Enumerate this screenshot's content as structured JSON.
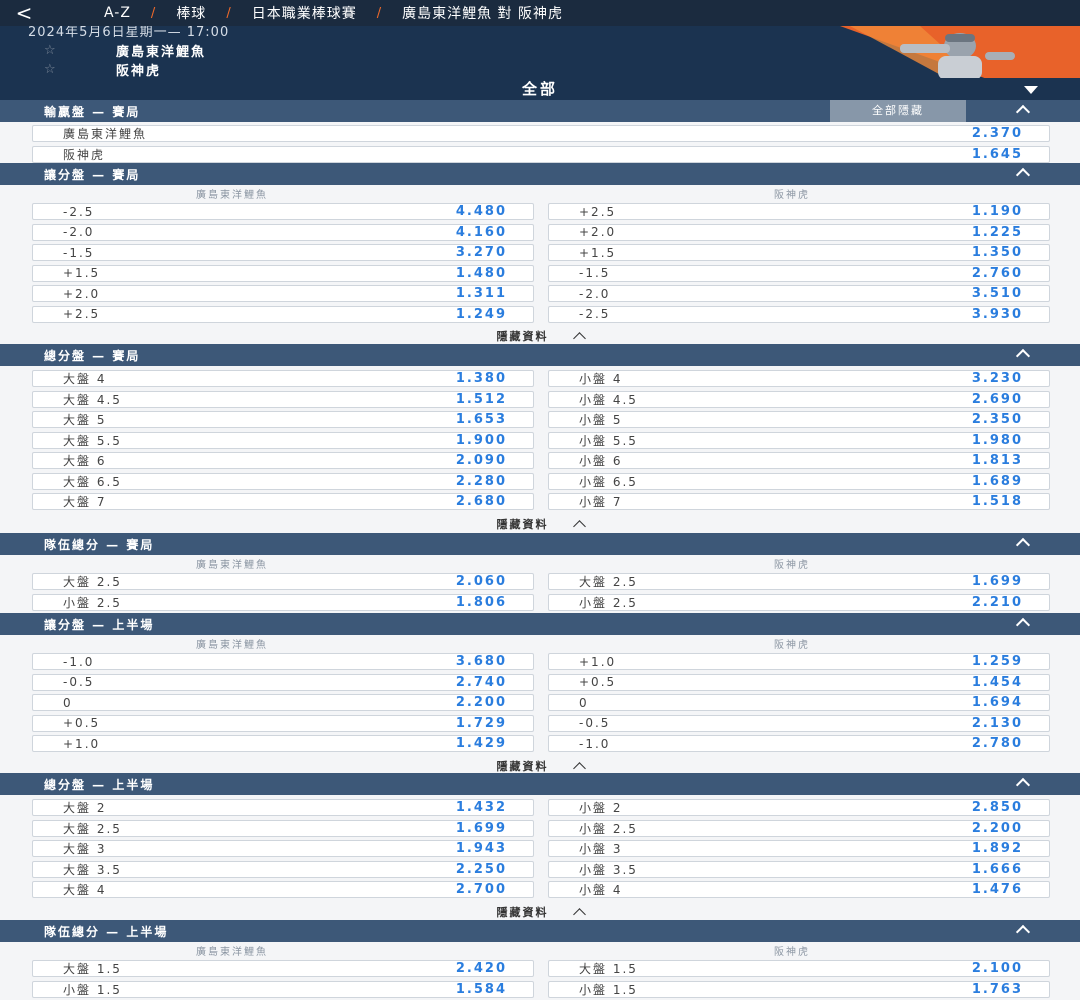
{
  "header": {
    "back": "<",
    "crumbs": [
      "A-Z",
      "棒球",
      "日本職業棒球賽",
      "廣島東洋鯉魚 對 阪神虎"
    ]
  },
  "match": {
    "datetime": "2024年5月6日星期一— 17:00",
    "home": "廣島東洋鯉魚",
    "away": "阪神虎",
    "star": "☆"
  },
  "filter": {
    "label": "全部"
  },
  "hide_all_label": "全部隱藏",
  "hide_data_label": "隱藏資料",
  "moneyline": {
    "title": "輸贏盤 — 賽局",
    "rows": [
      {
        "label": "廣島東洋鯉魚",
        "odds": "2.370"
      },
      {
        "label": "阪神虎",
        "odds": "1.645"
      }
    ]
  },
  "sections": [
    {
      "title": "讓分盤 — 賽局",
      "teams": [
        "廣島東洋鯉魚",
        "阪神虎"
      ],
      "rows": [
        [
          {
            "label": "-2.5",
            "odds": "4.480"
          },
          {
            "label": "+2.5",
            "odds": "1.190"
          }
        ],
        [
          {
            "label": "-2.0",
            "odds": "4.160"
          },
          {
            "label": "+2.0",
            "odds": "1.225"
          }
        ],
        [
          {
            "label": "-1.5",
            "odds": "3.270"
          },
          {
            "label": "+1.5",
            "odds": "1.350"
          }
        ],
        [
          {
            "label": "+1.5",
            "odds": "1.480"
          },
          {
            "label": "-1.5",
            "odds": "2.760"
          }
        ],
        [
          {
            "label": "+2.0",
            "odds": "1.311"
          },
          {
            "label": "-2.0",
            "odds": "3.510"
          }
        ],
        [
          {
            "label": "+2.5",
            "odds": "1.249"
          },
          {
            "label": "-2.5",
            "odds": "3.930"
          }
        ]
      ],
      "hide_data": true
    },
    {
      "title": "總分盤 — 賽局",
      "rows": [
        [
          {
            "label": "大盤 4",
            "odds": "1.380"
          },
          {
            "label": "小盤 4",
            "odds": "3.230"
          }
        ],
        [
          {
            "label": "大盤 4.5",
            "odds": "1.512"
          },
          {
            "label": "小盤 4.5",
            "odds": "2.690"
          }
        ],
        [
          {
            "label": "大盤 5",
            "odds": "1.653"
          },
          {
            "label": "小盤 5",
            "odds": "2.350"
          }
        ],
        [
          {
            "label": "大盤 5.5",
            "odds": "1.900"
          },
          {
            "label": "小盤 5.5",
            "odds": "1.980"
          }
        ],
        [
          {
            "label": "大盤 6",
            "odds": "2.090"
          },
          {
            "label": "小盤 6",
            "odds": "1.813"
          }
        ],
        [
          {
            "label": "大盤 6.5",
            "odds": "2.280"
          },
          {
            "label": "小盤 6.5",
            "odds": "1.689"
          }
        ],
        [
          {
            "label": "大盤 7",
            "odds": "2.680"
          },
          {
            "label": "小盤 7",
            "odds": "1.518"
          }
        ]
      ],
      "hide_data": true
    },
    {
      "title": "隊伍總分 — 賽局",
      "teams": [
        "廣島東洋鯉魚",
        "阪神虎"
      ],
      "rows": [
        [
          {
            "label": "大盤 2.5",
            "odds": "2.060"
          },
          {
            "label": "大盤 2.5",
            "odds": "1.699"
          }
        ],
        [
          {
            "label": "小盤 2.5",
            "odds": "1.806"
          },
          {
            "label": "小盤 2.5",
            "odds": "2.210"
          }
        ]
      ],
      "hide_data": false
    },
    {
      "title": "讓分盤 — 上半場",
      "teams": [
        "廣島東洋鯉魚",
        "阪神虎"
      ],
      "rows": [
        [
          {
            "label": "-1.0",
            "odds": "3.680"
          },
          {
            "label": "+1.0",
            "odds": "1.259"
          }
        ],
        [
          {
            "label": "-0.5",
            "odds": "2.740"
          },
          {
            "label": "+0.5",
            "odds": "1.454"
          }
        ],
        [
          {
            "label": "0",
            "odds": "2.200"
          },
          {
            "label": "0",
            "odds": "1.694"
          }
        ],
        [
          {
            "label": "+0.5",
            "odds": "1.729"
          },
          {
            "label": "-0.5",
            "odds": "2.130"
          }
        ],
        [
          {
            "label": "+1.0",
            "odds": "1.429"
          },
          {
            "label": "-1.0",
            "odds": "2.780"
          }
        ]
      ],
      "hide_data": true
    },
    {
      "title": "總分盤 — 上半場",
      "rows": [
        [
          {
            "label": "大盤 2",
            "odds": "1.432"
          },
          {
            "label": "小盤 2",
            "odds": "2.850"
          }
        ],
        [
          {
            "label": "大盤 2.5",
            "odds": "1.699"
          },
          {
            "label": "小盤 2.5",
            "odds": "2.200"
          }
        ],
        [
          {
            "label": "大盤 3",
            "odds": "1.943"
          },
          {
            "label": "小盤 3",
            "odds": "1.892"
          }
        ],
        [
          {
            "label": "大盤 3.5",
            "odds": "2.250"
          },
          {
            "label": "小盤 3.5",
            "odds": "1.666"
          }
        ],
        [
          {
            "label": "大盤 4",
            "odds": "2.700"
          },
          {
            "label": "小盤 4",
            "odds": "1.476"
          }
        ]
      ],
      "hide_data": true
    },
    {
      "title": "隊伍總分 — 上半場",
      "teams": [
        "廣島東洋鯉魚",
        "阪神虎"
      ],
      "rows": [
        [
          {
            "label": "大盤 1.5",
            "odds": "2.420"
          },
          {
            "label": "大盤 1.5",
            "odds": "2.100"
          }
        ],
        [
          {
            "label": "小盤 1.5",
            "odds": "1.584"
          },
          {
            "label": "小盤 1.5",
            "odds": "1.763"
          }
        ]
      ],
      "hide_data": false
    }
  ]
}
